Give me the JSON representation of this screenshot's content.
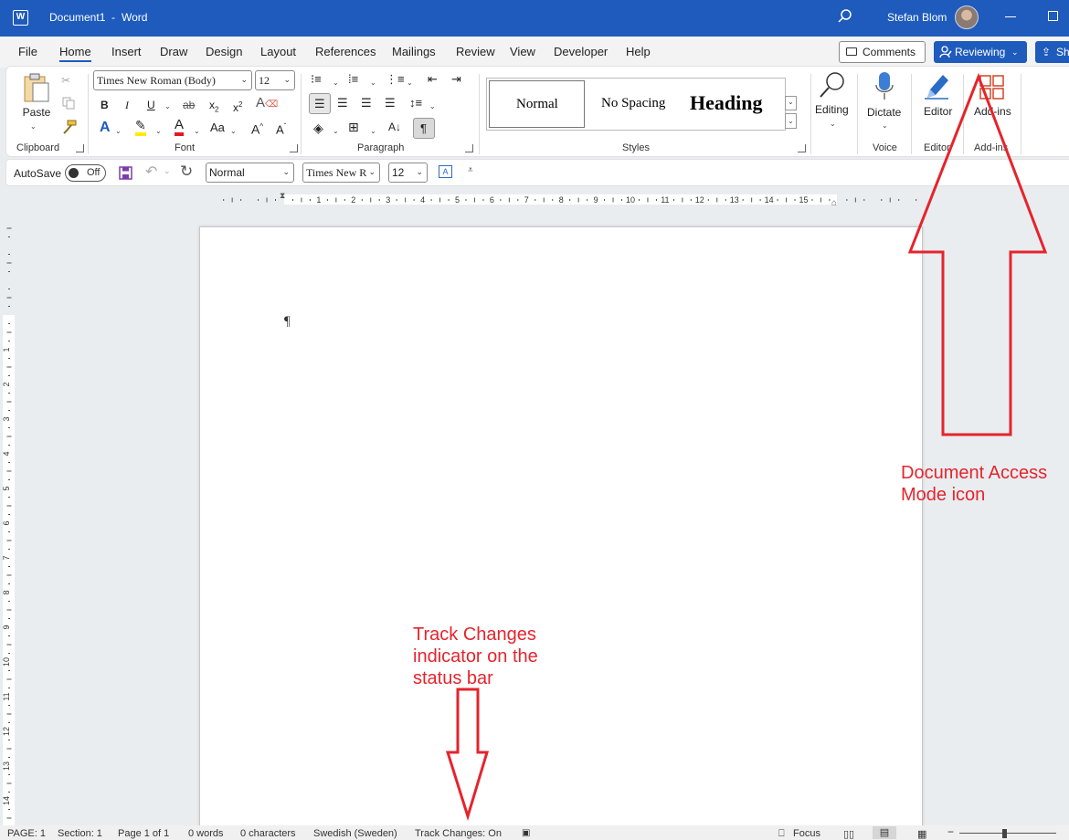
{
  "titlebar": {
    "doc_name": "Document1",
    "separator": "-",
    "app_name": "Word",
    "user_name": "Stefan Blom",
    "app_logo": "W"
  },
  "tabs": [
    "File",
    "Home",
    "Insert",
    "Draw",
    "Design",
    "Layout",
    "References",
    "Mailings",
    "Review",
    "View",
    "Developer",
    "Help"
  ],
  "active_tab": "Home",
  "actions": {
    "comments": "Comments",
    "reviewing": "Reviewing",
    "share": "Sh"
  },
  "ribbon": {
    "clipboard": {
      "label": "Clipboard",
      "paste": "Paste"
    },
    "font": {
      "label": "Font",
      "name": "Times New Roman (Body)",
      "size": "12",
      "bold": "B",
      "italic": "I",
      "underline": "U",
      "strike": "ab",
      "sub": "x",
      "sup": "x",
      "case": "Aa"
    },
    "paragraph": {
      "label": "Paragraph"
    },
    "styles": {
      "label": "Styles",
      "items": [
        "Normal",
        "No Spacing",
        "Heading"
      ]
    },
    "editing": {
      "label": "Editing"
    },
    "voice": {
      "label": "Voice",
      "dictate": "Dictate"
    },
    "editor": {
      "label": "Editor",
      "button": "Editor"
    },
    "addins": {
      "label": "Add-ins",
      "button": "Add-ins"
    }
  },
  "qat": {
    "autosave": "AutoSave",
    "toggle": "Off",
    "style": "Normal",
    "font": "Times New R",
    "size": "12"
  },
  "ruler_numbers": [
    "1",
    "2",
    "3",
    "4",
    "5",
    "6",
    "7",
    "8",
    "9",
    "10",
    "11",
    "12",
    "13",
    "14",
    "15"
  ],
  "vruler_numbers": [
    "1",
    "2",
    "3",
    "4",
    "5",
    "6",
    "7",
    "8",
    "9",
    "10",
    "11",
    "12",
    "13",
    "14"
  ],
  "document": {
    "pilcrow": "¶"
  },
  "annotations": {
    "doc_access": [
      "Document Access",
      "Mode icon"
    ],
    "track_changes": [
      "Track Changes",
      "indicator on the",
      "status bar"
    ]
  },
  "statusbar": {
    "page": "PAGE: 1",
    "section": "Section: 1",
    "page_of": "Page 1 of 1",
    "words": "0 words",
    "chars": "0 characters",
    "language": "Swedish (Sweden)",
    "track_changes": "Track Changes: On",
    "focus": "Focus"
  },
  "colors": {
    "accent": "#1e5bbd",
    "annotation": "#e5242c"
  }
}
